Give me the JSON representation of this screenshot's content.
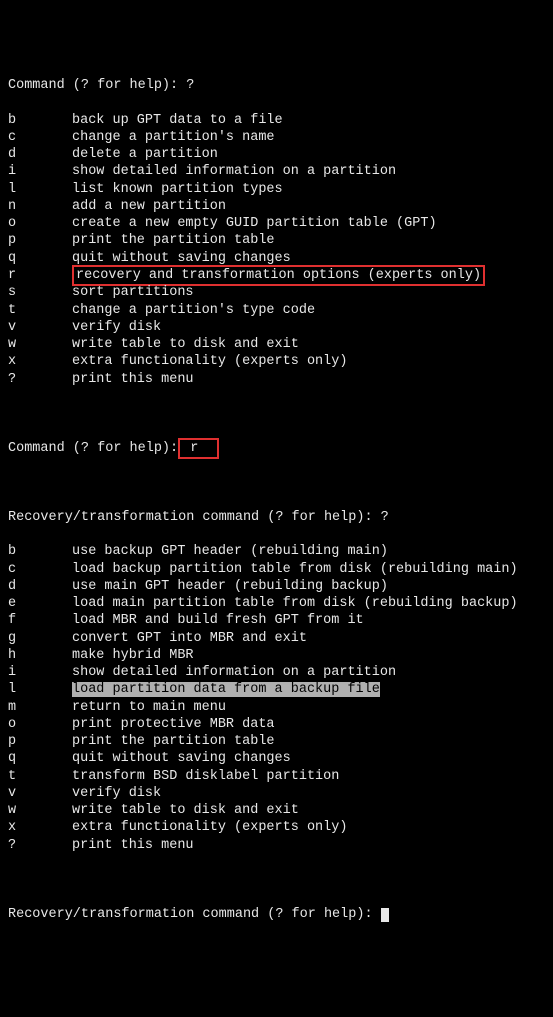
{
  "prompt1": "Command (? for help): ?",
  "menu1": [
    {
      "key": "b",
      "desc": "back up GPT data to a file"
    },
    {
      "key": "c",
      "desc": "change a partition's name"
    },
    {
      "key": "d",
      "desc": "delete a partition"
    },
    {
      "key": "i",
      "desc": "show detailed information on a partition"
    },
    {
      "key": "l",
      "desc": "list known partition types"
    },
    {
      "key": "n",
      "desc": "add a new partition"
    },
    {
      "key": "o",
      "desc": "create a new empty GUID partition table (GPT)"
    },
    {
      "key": "p",
      "desc": "print the partition table"
    },
    {
      "key": "q",
      "desc": "quit without saving changes"
    },
    {
      "key": "r",
      "desc": "recovery and transformation options (experts only)",
      "boxed": true
    },
    {
      "key": "s",
      "desc": "sort partitions"
    },
    {
      "key": "t",
      "desc": "change a partition's type code"
    },
    {
      "key": "v",
      "desc": "verify disk"
    },
    {
      "key": "w",
      "desc": "write table to disk and exit"
    },
    {
      "key": "x",
      "desc": "extra functionality (experts only)"
    },
    {
      "key": "?",
      "desc": "print this menu"
    }
  ],
  "prompt2_left": "Command (? for help):",
  "prompt2_input": " r  ",
  "prompt3": "Recovery/transformation command (? for help): ?",
  "menu2": [
    {
      "key": "b",
      "desc": "use backup GPT header (rebuilding main)"
    },
    {
      "key": "c",
      "desc": "load backup partition table from disk (rebuilding main)"
    },
    {
      "key": "d",
      "desc": "use main GPT header (rebuilding backup)"
    },
    {
      "key": "e",
      "desc": "load main partition table from disk (rebuilding backup)"
    },
    {
      "key": "f",
      "desc": "load MBR and build fresh GPT from it"
    },
    {
      "key": "g",
      "desc": "convert GPT into MBR and exit"
    },
    {
      "key": "h",
      "desc": "make hybrid MBR"
    },
    {
      "key": "i",
      "desc": "show detailed information on a partition"
    },
    {
      "key": "l",
      "desc": "load partition data from a backup file",
      "highlight": true
    },
    {
      "key": "m",
      "desc": "return to main menu"
    },
    {
      "key": "o",
      "desc": "print protective MBR data"
    },
    {
      "key": "p",
      "desc": "print the partition table"
    },
    {
      "key": "q",
      "desc": "quit without saving changes"
    },
    {
      "key": "t",
      "desc": "transform BSD disklabel partition"
    },
    {
      "key": "v",
      "desc": "verify disk"
    },
    {
      "key": "w",
      "desc": "write table to disk and exit"
    },
    {
      "key": "x",
      "desc": "extra functionality (experts only)"
    },
    {
      "key": "?",
      "desc": "print this menu"
    }
  ],
  "prompt4": "Recovery/transformation command (? for help): "
}
